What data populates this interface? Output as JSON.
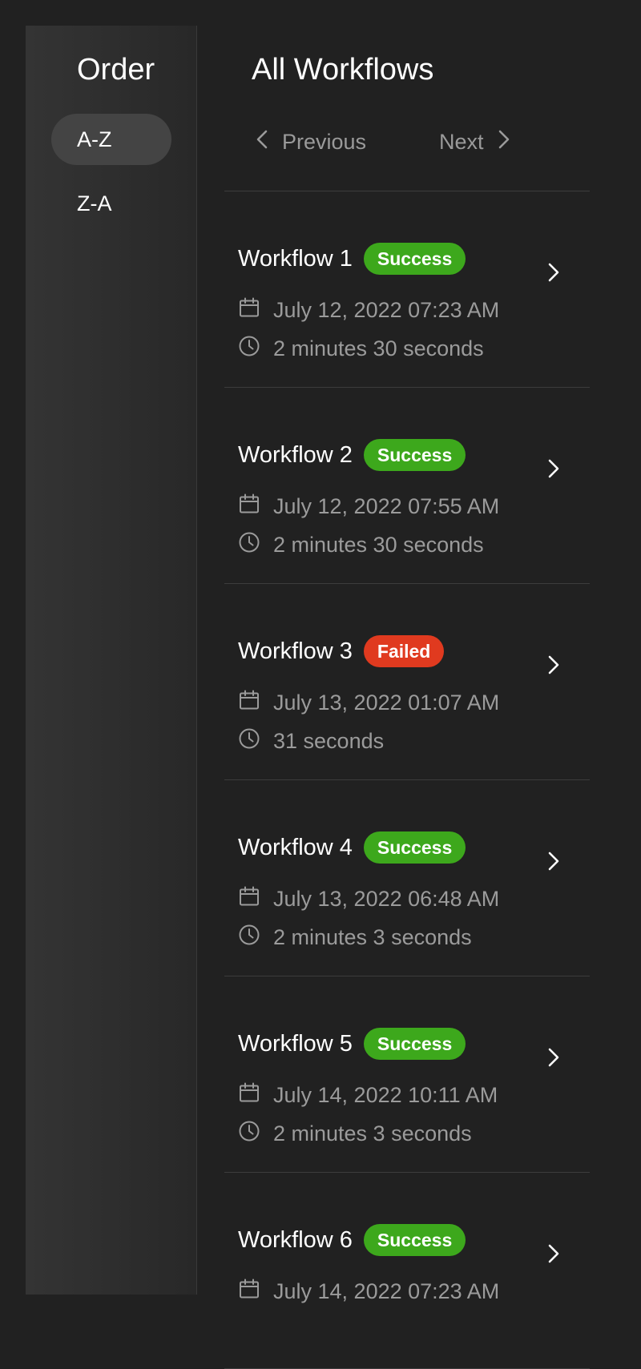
{
  "sidebar": {
    "title": "Order",
    "options": [
      {
        "label": "A-Z",
        "active": true
      },
      {
        "label": "Z-A",
        "active": false
      }
    ]
  },
  "main": {
    "title": "All Workflows",
    "pager": {
      "previous_label": "Previous",
      "next_label": "Next"
    },
    "workflows": [
      {
        "name": "Workflow 1",
        "status": "Success",
        "date": "July 12, 2022 07:23 AM",
        "duration": "2 minutes 30 seconds"
      },
      {
        "name": "Workflow 2",
        "status": "Success",
        "date": "July 12, 2022 07:55 AM",
        "duration": "2 minutes 30 seconds"
      },
      {
        "name": "Workflow 3",
        "status": "Failed",
        "date": "July 13, 2022 01:07 AM",
        "duration": "31 seconds"
      },
      {
        "name": "Workflow 4",
        "status": "Success",
        "date": "July 13, 2022 06:48 AM",
        "duration": "2 minutes 3 seconds"
      },
      {
        "name": "Workflow 5",
        "status": "Success",
        "date": "July 14, 2022 10:11 AM",
        "duration": "2 minutes 3 seconds"
      },
      {
        "name": "Workflow 6",
        "status": "Success",
        "date": "July 14, 2022 07:23 AM",
        "duration": ""
      }
    ]
  },
  "colors": {
    "background": "#212121",
    "success": "#3da81c",
    "failed": "#e03a1f",
    "muted_text": "#9b9b9b"
  },
  "icons": {
    "date": "calendar-icon",
    "duration": "clock-icon",
    "open": "chevron-right-icon",
    "previous": "chevron-left-icon",
    "next": "chevron-right-icon"
  }
}
